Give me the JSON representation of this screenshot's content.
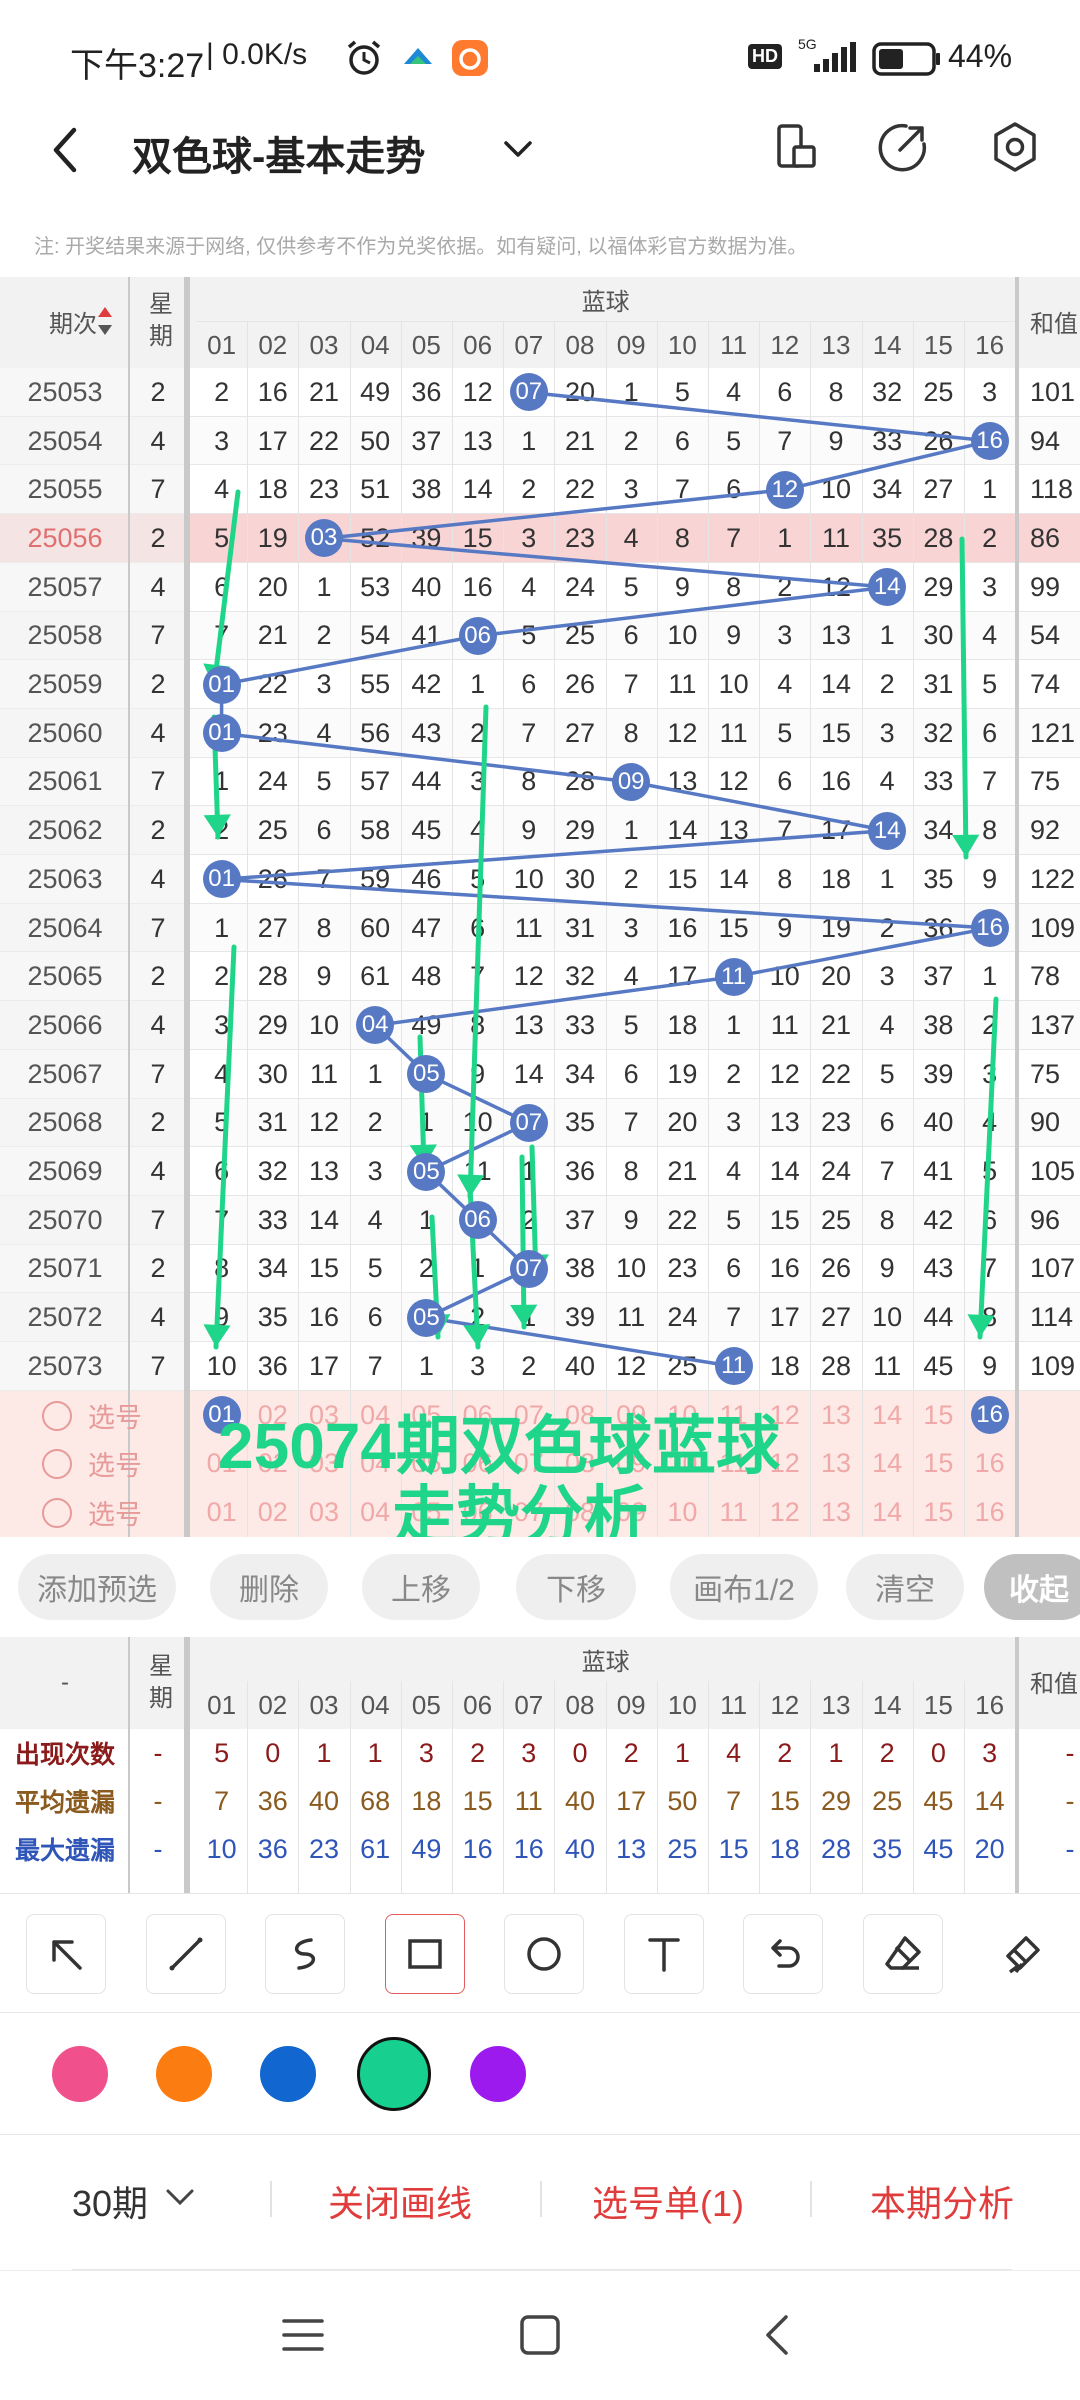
{
  "status_bar": {
    "time": "下午3:27",
    "net_speed": "| 0.0K/s",
    "hd": "HD",
    "signal": "5G",
    "battery": "44%",
    "icons": [
      "alarm-icon",
      "app-notification-icon",
      "app-notification-icon-2",
      "signal-icon",
      "battery-icon"
    ]
  },
  "header": {
    "title": "双色球-基本走势",
    "icons": [
      "back-icon",
      "chevron-down-icon",
      "device-rotate-icon",
      "share-icon",
      "settings-icon"
    ]
  },
  "notice": "注: 开奖结果来源于网络, 仅供参考不作为兑奖依据。如有疑问, 以福体彩官方数据为准。",
  "grid": {
    "col_issue": "期次",
    "col_weekday": "星期",
    "section_blue": "蓝球",
    "col_sum": "和值",
    "columns": [
      "01",
      "02",
      "03",
      "04",
      "05",
      "06",
      "07",
      "08",
      "09",
      "10",
      "11",
      "12",
      "13",
      "14",
      "15",
      "16"
    ],
    "rows": [
      {
        "issue": "25053",
        "week": "2",
        "cells": [
          "2",
          "16",
          "21",
          "49",
          "36",
          "12",
          "07",
          "20",
          "1",
          "5",
          "4",
          "6",
          "8",
          "32",
          "25",
          "3"
        ],
        "hit": 7,
        "sum": "101"
      },
      {
        "issue": "25054",
        "week": "4",
        "cells": [
          "3",
          "17",
          "22",
          "50",
          "37",
          "13",
          "1",
          "21",
          "2",
          "6",
          "5",
          "7",
          "9",
          "33",
          "26",
          "16"
        ],
        "hit": 16,
        "sum": "94"
      },
      {
        "issue": "25055",
        "week": "7",
        "cells": [
          "4",
          "18",
          "23",
          "51",
          "38",
          "14",
          "2",
          "22",
          "3",
          "7",
          "6",
          "12",
          "10",
          "34",
          "27",
          "1"
        ],
        "hit": 12,
        "sum": "118"
      },
      {
        "issue": "25056",
        "week": "2",
        "cells": [
          "5",
          "19",
          "03",
          "52",
          "39",
          "15",
          "3",
          "23",
          "4",
          "8",
          "7",
          "1",
          "11",
          "35",
          "28",
          "2"
        ],
        "hit": 3,
        "sum": "86",
        "highlight": true
      },
      {
        "issue": "25057",
        "week": "4",
        "cells": [
          "6",
          "20",
          "1",
          "53",
          "40",
          "16",
          "4",
          "24",
          "5",
          "9",
          "8",
          "2",
          "12",
          "14",
          "29",
          "3"
        ],
        "hit": 14,
        "sum": "99"
      },
      {
        "issue": "25058",
        "week": "7",
        "cells": [
          "7",
          "21",
          "2",
          "54",
          "41",
          "06",
          "5",
          "25",
          "6",
          "10",
          "9",
          "3",
          "13",
          "1",
          "30",
          "4"
        ],
        "hit": 6,
        "sum": "54"
      },
      {
        "issue": "25059",
        "week": "2",
        "cells": [
          "01",
          "22",
          "3",
          "55",
          "42",
          "1",
          "6",
          "26",
          "7",
          "11",
          "10",
          "4",
          "14",
          "2",
          "31",
          "5"
        ],
        "hit": 1,
        "sum": "74"
      },
      {
        "issue": "25060",
        "week": "4",
        "cells": [
          "01",
          "23",
          "4",
          "56",
          "43",
          "2",
          "7",
          "27",
          "8",
          "12",
          "11",
          "5",
          "15",
          "3",
          "32",
          "6"
        ],
        "hit": 1,
        "sum": "121"
      },
      {
        "issue": "25061",
        "week": "7",
        "cells": [
          "1",
          "24",
          "5",
          "57",
          "44",
          "3",
          "8",
          "28",
          "09",
          "13",
          "12",
          "6",
          "16",
          "4",
          "33",
          "7"
        ],
        "hit": 9,
        "sum": "75"
      },
      {
        "issue": "25062",
        "week": "2",
        "cells": [
          "2",
          "25",
          "6",
          "58",
          "45",
          "4",
          "9",
          "29",
          "1",
          "14",
          "13",
          "7",
          "17",
          "14",
          "34",
          "8"
        ],
        "hit": 14,
        "sum": "92"
      },
      {
        "issue": "25063",
        "week": "4",
        "cells": [
          "01",
          "26",
          "7",
          "59",
          "46",
          "5",
          "10",
          "30",
          "2",
          "15",
          "14",
          "8",
          "18",
          "1",
          "35",
          "9"
        ],
        "hit": 1,
        "sum": "122"
      },
      {
        "issue": "25064",
        "week": "7",
        "cells": [
          "1",
          "27",
          "8",
          "60",
          "47",
          "6",
          "11",
          "31",
          "3",
          "16",
          "15",
          "9",
          "19",
          "2",
          "36",
          "16"
        ],
        "hit": 16,
        "sum": "109"
      },
      {
        "issue": "25065",
        "week": "2",
        "cells": [
          "2",
          "28",
          "9",
          "61",
          "48",
          "7",
          "12",
          "32",
          "4",
          "17",
          "11",
          "10",
          "20",
          "3",
          "37",
          "1"
        ],
        "hit": 11,
        "sum": "78"
      },
      {
        "issue": "25066",
        "week": "4",
        "cells": [
          "3",
          "29",
          "10",
          "04",
          "49",
          "8",
          "13",
          "33",
          "5",
          "18",
          "1",
          "11",
          "21",
          "4",
          "38",
          "2"
        ],
        "hit": 4,
        "sum": "137"
      },
      {
        "issue": "25067",
        "week": "7",
        "cells": [
          "4",
          "30",
          "11",
          "1",
          "05",
          "9",
          "14",
          "34",
          "6",
          "19",
          "2",
          "12",
          "22",
          "5",
          "39",
          "3"
        ],
        "hit": 5,
        "sum": "75"
      },
      {
        "issue": "25068",
        "week": "2",
        "cells": [
          "5",
          "31",
          "12",
          "2",
          "1",
          "10",
          "07",
          "35",
          "7",
          "20",
          "3",
          "13",
          "23",
          "6",
          "40",
          "4"
        ],
        "hit": 7,
        "sum": "90"
      },
      {
        "issue": "25069",
        "week": "4",
        "cells": [
          "6",
          "32",
          "13",
          "3",
          "05",
          "11",
          "1",
          "36",
          "8",
          "21",
          "4",
          "14",
          "24",
          "7",
          "41",
          "5"
        ],
        "hit": 5,
        "sum": "105"
      },
      {
        "issue": "25070",
        "week": "7",
        "cells": [
          "7",
          "33",
          "14",
          "4",
          "1",
          "06",
          "2",
          "37",
          "9",
          "22",
          "5",
          "15",
          "25",
          "8",
          "42",
          "6"
        ],
        "hit": 6,
        "sum": "96"
      },
      {
        "issue": "25071",
        "week": "2",
        "cells": [
          "8",
          "34",
          "15",
          "5",
          "2",
          "1",
          "07",
          "38",
          "10",
          "23",
          "6",
          "16",
          "26",
          "9",
          "43",
          "7"
        ],
        "hit": 7,
        "sum": "107"
      },
      {
        "issue": "25072",
        "week": "4",
        "cells": [
          "9",
          "35",
          "16",
          "6",
          "05",
          "2",
          "1",
          "39",
          "11",
          "24",
          "7",
          "17",
          "27",
          "10",
          "44",
          "8"
        ],
        "hit": 5,
        "sum": "114"
      },
      {
        "issue": "25073",
        "week": "7",
        "cells": [
          "10",
          "36",
          "17",
          "7",
          "1",
          "3",
          "2",
          "40",
          "12",
          "25",
          "11",
          "18",
          "28",
          "11",
          "45",
          "9"
        ],
        "hit": 11,
        "sum": "109"
      }
    ],
    "pick_label": "选号",
    "pick_rows": 3,
    "pick_ball_left": "01",
    "pick_ball_right": "16",
    "annotation_line1": "25074期双色球蓝球",
    "annotation_line2": "走势分析"
  },
  "buttons": [
    "添加预选",
    "删除",
    "上移",
    "下移",
    "画布1/2",
    "清空",
    "收起"
  ],
  "stats": {
    "col_first": "-",
    "col_weekday": "星期",
    "section_blue": "蓝球",
    "col_sum": "和值",
    "rows": [
      {
        "label": "出现次数",
        "week": "-",
        "values": [
          "5",
          "0",
          "1",
          "1",
          "3",
          "2",
          "3",
          "0",
          "2",
          "1",
          "4",
          "2",
          "1",
          "2",
          "0",
          "3"
        ],
        "sum": "-",
        "color": "#8b1a1a"
      },
      {
        "label": "平均遗漏",
        "week": "-",
        "values": [
          "7",
          "36",
          "40",
          "68",
          "18",
          "15",
          "11",
          "40",
          "17",
          "50",
          "7",
          "15",
          "29",
          "25",
          "45",
          "14"
        ],
        "sum": "-",
        "color": "#8a5a1e"
      },
      {
        "label": "最大遗漏",
        "week": "-",
        "values": [
          "10",
          "36",
          "23",
          "61",
          "49",
          "16",
          "16",
          "40",
          "13",
          "25",
          "15",
          "18",
          "28",
          "35",
          "45",
          "20"
        ],
        "sum": "-",
        "color": "#2f55b8"
      }
    ]
  },
  "tools": [
    "arrow-tool-icon",
    "line-tool-icon",
    "freehand-tool-icon",
    "rectangle-tool-icon",
    "circle-tool-icon",
    "text-tool-icon",
    "undo-icon",
    "eraser-icon",
    "clear-brush-icon"
  ],
  "colors": [
    "#f0508c",
    "#fb7c10",
    "#1266d0",
    "#17cf8f",
    "#9c1aee"
  ],
  "bottom_bar": {
    "period": "30期",
    "close_lines": "关闭画线",
    "selection": "选号单(1)",
    "analysis": "本期分析"
  },
  "nav": [
    "menu-icon",
    "home-icon",
    "back-icon"
  ],
  "accent_color": "#e03c3c",
  "ball_color": "#5779c4",
  "draw_color": "#1fd58a"
}
